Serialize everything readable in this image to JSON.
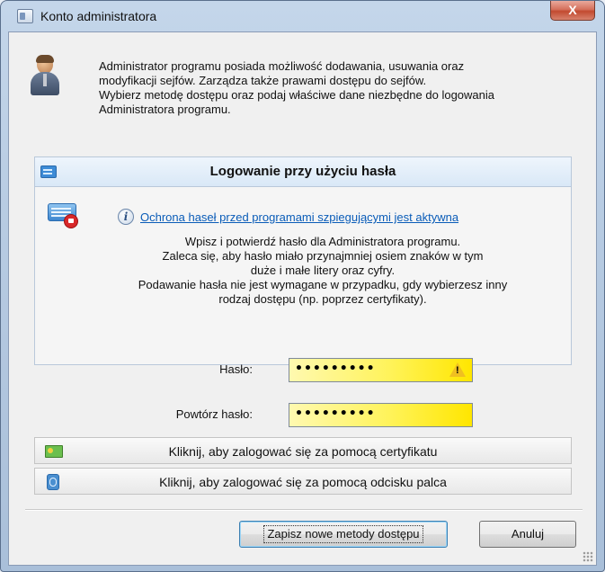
{
  "window": {
    "title": "Konto administratora",
    "close_label": "X"
  },
  "intro": {
    "lines": [
      "Administrator programu posiada możliwość dodawania, usuwania oraz",
      "modyfikacji sejfów. Zarządza także prawami dostępu do sejfów.",
      "Wybierz metodę dostępu oraz podaj właściwe dane niezbędne do logowania",
      "Administratora programu."
    ]
  },
  "password_panel": {
    "title": "Logowanie przy użyciu hasła",
    "spy_link": "Ochrona haseł przed programami szpiegującymi jest aktywna",
    "description_lines": [
      "Wpisz i potwierdź hasło dla Administratora programu.",
      "Zaleca się, aby hasło miało przynajmniej osiem znaków w tym",
      "duże i małe litery oraz cyfry.",
      "Podawanie hasła nie jest wymagane w przypadku, gdy wybierzesz inny",
      "rodzaj dostępu (np. poprzez certyfikaty)."
    ],
    "password_label": "Hasło:",
    "password_value": "•••••••••",
    "repeat_label": "Powtórz hasło:",
    "repeat_value": "•••••••••",
    "field_colors": [
      "#fff9b0",
      "#ffe600"
    ],
    "warning_icon": "warning-icon"
  },
  "alternatives": {
    "certificate": "Kliknij, aby zalogować się za pomocą certyfikatu",
    "fingerprint": "Kliknij, aby zalogować się za pomocą odcisku palca"
  },
  "buttons": {
    "save": "Zapisz nowe metody dostępu",
    "cancel": "Anuluj"
  }
}
